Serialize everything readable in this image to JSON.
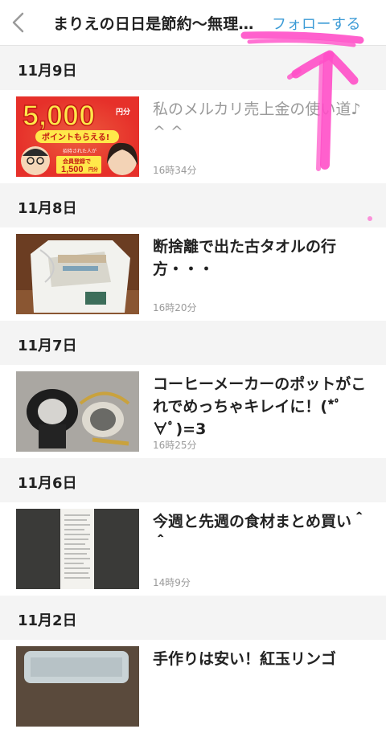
{
  "header": {
    "title": "まりえの日日是節約〜無理…",
    "follow_label": "フォローする"
  },
  "sections": [
    {
      "date": "11月9日",
      "entry": {
        "title": "私のメルカリ売上金の使い道♪",
        "title_extra": "^ ^",
        "time": "16時34分",
        "thumbnail": "ad-banner",
        "banner_amount": "5,000",
        "banner_unit": "円分",
        "banner_line1": "ポイントもらえる!",
        "banner_line2": "招待された人が",
        "banner_line3": "会員登録で",
        "banner_line4": "1,500",
        "banner_line4_unit": "円分"
      }
    },
    {
      "date": "11月8日",
      "entry": {
        "title": "断捨離で出た古タオルの行方・・・",
        "time": "16時20分",
        "thumbnail": "towel-bag-photo"
      }
    },
    {
      "date": "11月7日",
      "entry": {
        "title": "コーヒーメーカーのポットがこれでめっちゃキレイに！(*ﾟ∀ﾟ)=3",
        "time": "16時25分",
        "thumbnail": "coffee-pot-photo"
      }
    },
    {
      "date": "11月6日",
      "entry": {
        "title": "今週と先週の食材まとめ買い＾＾",
        "time": "14時9分",
        "thumbnail": "receipt-photo"
      }
    },
    {
      "date": "11月2日",
      "entry": {
        "title": "手作りは安い！紅玉リンゴ",
        "time": "",
        "thumbnail": "jar-photo"
      }
    }
  ],
  "colors": {
    "accent": "#3b9bd6",
    "annotation": "#ff4fc8",
    "section_bg": "#f4f4f4"
  }
}
